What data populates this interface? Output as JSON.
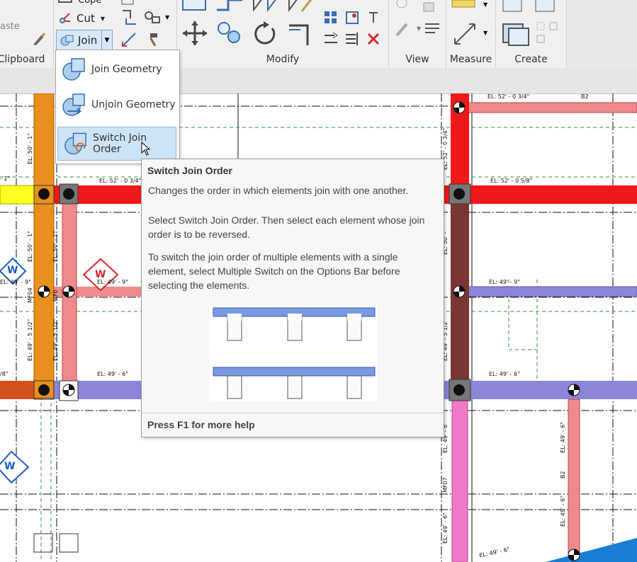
{
  "ribbon": {
    "panels": [
      {
        "label": "Clipboard"
      },
      {
        "label": "Modify"
      },
      {
        "label": "View"
      },
      {
        "label": "Measure"
      },
      {
        "label": "Create"
      }
    ],
    "paste_label": "aste",
    "cope_label": "Cope",
    "cut_label": "Cut",
    "join_label": "Join"
  },
  "join_menu": {
    "items": [
      {
        "label": "Join Geometry",
        "icon": "join-geometry-icon"
      },
      {
        "label": "Unjoin Geometry",
        "icon": "unjoin-geometry-icon"
      },
      {
        "label": "Switch Join Order",
        "icon": "switch-join-order-icon"
      }
    ]
  },
  "tooltip": {
    "title": "Switch Join Order",
    "p1": "Changes the order in which elements join with one another.",
    "p2": "Select Switch Join Order. Then select each element whose join order is to be reversed.",
    "p3": "To switch the join order of multiple elements with a single element, select Multiple Switch on the Options Bar before selecting the elements.",
    "footer": "Press F1 for more help"
  },
  "drawing": {
    "colors": {
      "orange": "#e8901c",
      "red": "#f01818",
      "pink": "#f08a8a",
      "yellow": "#ffff20",
      "brown": "#7b3535",
      "purple": "#8a86d8",
      "magenta": "#f07ac8",
      "blue": "#1a7fd4",
      "rust": "#d45020"
    },
    "labels": {
      "el_52_0_34_top": "EL: 52' - 0 3/4\"",
      "b2": "B2",
      "el_52_0_34_mid": "EL: 52' - 0 3/4\"",
      "el_52_0_58": "EL: 52' - 0 5/8\"",
      "el_minus1": "- 1\"",
      "el_49_9_left": "EL: 49' - 9\"",
      "el_49_9_mid": "EL: 49' - 9\"",
      "el_49_9_right": "EL: 49' - 9\"",
      "el_49_6_left": "EL: 49' - 6\"",
      "el_49_6_right": "EL: 49' - 6\"",
      "el_49_6_bottom": "EL: 49' - 6\"",
      "left_edge": "/8\"",
      "v_el_50_1": "EL: 50' - 1\"",
      "v_el_50_1b": "EL: 50' - 1\"",
      "v_el_50_1c": "EL: 50' - 1\"",
      "v_el_52_0_34": "EL: 52' - 0 3/4\"",
      "v_el_50": "EL: 50' -",
      "v_el_49_5_12a": "EL: 49' - 5 1/2\"",
      "v_el_49_5_12b": "EL: 49' - 5 1/2\"",
      "v_el_49_5_12c": "EL: 49' - 5 1/2\"",
      "v_mf04": "MF04",
      "v_mf0": "MF0",
      "v_mf07": "MF07",
      "v_el_49_6_a": "EL: 49' - 6\"",
      "v_el_49_6_b": "EL: 49' - 6\"",
      "v_el_49_6_c": "EL: 49' - 6\"",
      "v_el_49_6_d": "EL: 49' - 6\"",
      "v_b2": "B2",
      "w1": "W",
      "w2": "W",
      "w3": "W"
    }
  }
}
